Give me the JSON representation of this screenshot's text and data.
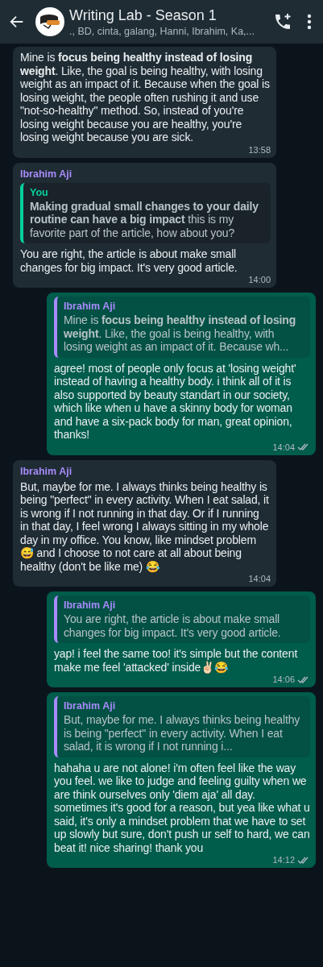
{
  "header": {
    "title": "Writing Lab - Season 1",
    "subtitle": "., BD, cinta, galang, Hanni, Ibrahim, Ka,..."
  },
  "messages": [
    {
      "kind": "incoming",
      "text": "Mine is **focus being healthy instead of losing weight**. Like, the goal is being healthy, with losing weight as an impact of it. Because when the goal is losing weight, the people often rushing it and use \"not-so-healthy\" method. So, instead of you're losing weight because you are healthy, you're losing weight because you are sick.",
      "time": "13:58"
    },
    {
      "kind": "incoming",
      "sender": "Ibrahim Aji",
      "quote": {
        "author": "You",
        "color": "#06cf9c",
        "text": "**Making gradual small changes to your daily routine can have a big impact** this is my favorite part of the article, how about you?"
      },
      "text": "You are right, the article is about make small changes for big impact. It's very good article.",
      "time": "14:00"
    },
    {
      "kind": "outgoing",
      "quote": {
        "author": "Ibrahim Aji",
        "color": "#a78bfa",
        "text": "Mine is **focus being healthy instead of losing weight**. Like, the goal is being healthy, with losing weight as an impact of it. Because wh..."
      },
      "text": "agree! most of people only focus at 'losing weight' instead of having a healthy body. i think all of it is also supported by beauty standart in our society, which like when u have a skinny body for woman and have a six-pack body for man, great opinion, thanks!",
      "time": "14:04",
      "delivered": true
    },
    {
      "kind": "incoming",
      "sender": "Ibrahim Aji",
      "text": "But, maybe for me. I always thinks being healthy is being \"perfect\" in every activity. When I eat salad, it is wrong if I not running in that day. Or if I running in that day, I feel wrong I always sitting in my whole day in my office. You know, like mindset problem 😅 and I choose to not care at all about being healthy (don't be like me) 😂",
      "time": "14:04"
    },
    {
      "kind": "outgoing",
      "quote": {
        "author": "Ibrahim Aji",
        "color": "#a78bfa",
        "text": "You are right, the article is about make small changes for big impact. It's very good article."
      },
      "text": "yap! i feel the same too! it's simple but the content make me feel 'attacked' inside✌🏻😂",
      "time": "14:06",
      "delivered": true
    },
    {
      "kind": "outgoing",
      "quote": {
        "author": "Ibrahim Aji",
        "color": "#a78bfa",
        "text": "But, maybe for me. I always thinks being healthy is being \"perfect\" in every activity. When I eat salad, it is wrong if I not running i..."
      },
      "text": "hahaha u are not alone! i'm often feel like the way you feel. we like to judge and feeling guilty when we are think ourselves only 'diem aja' all day. sometimes it's good for a reason, but yea like what u said, it's only a mindset problem that we have to set up slowly but sure, don't push ur self to hard, we can beat it! nice sharing! thank you",
      "time": "14:12",
      "delivered": true
    }
  ]
}
